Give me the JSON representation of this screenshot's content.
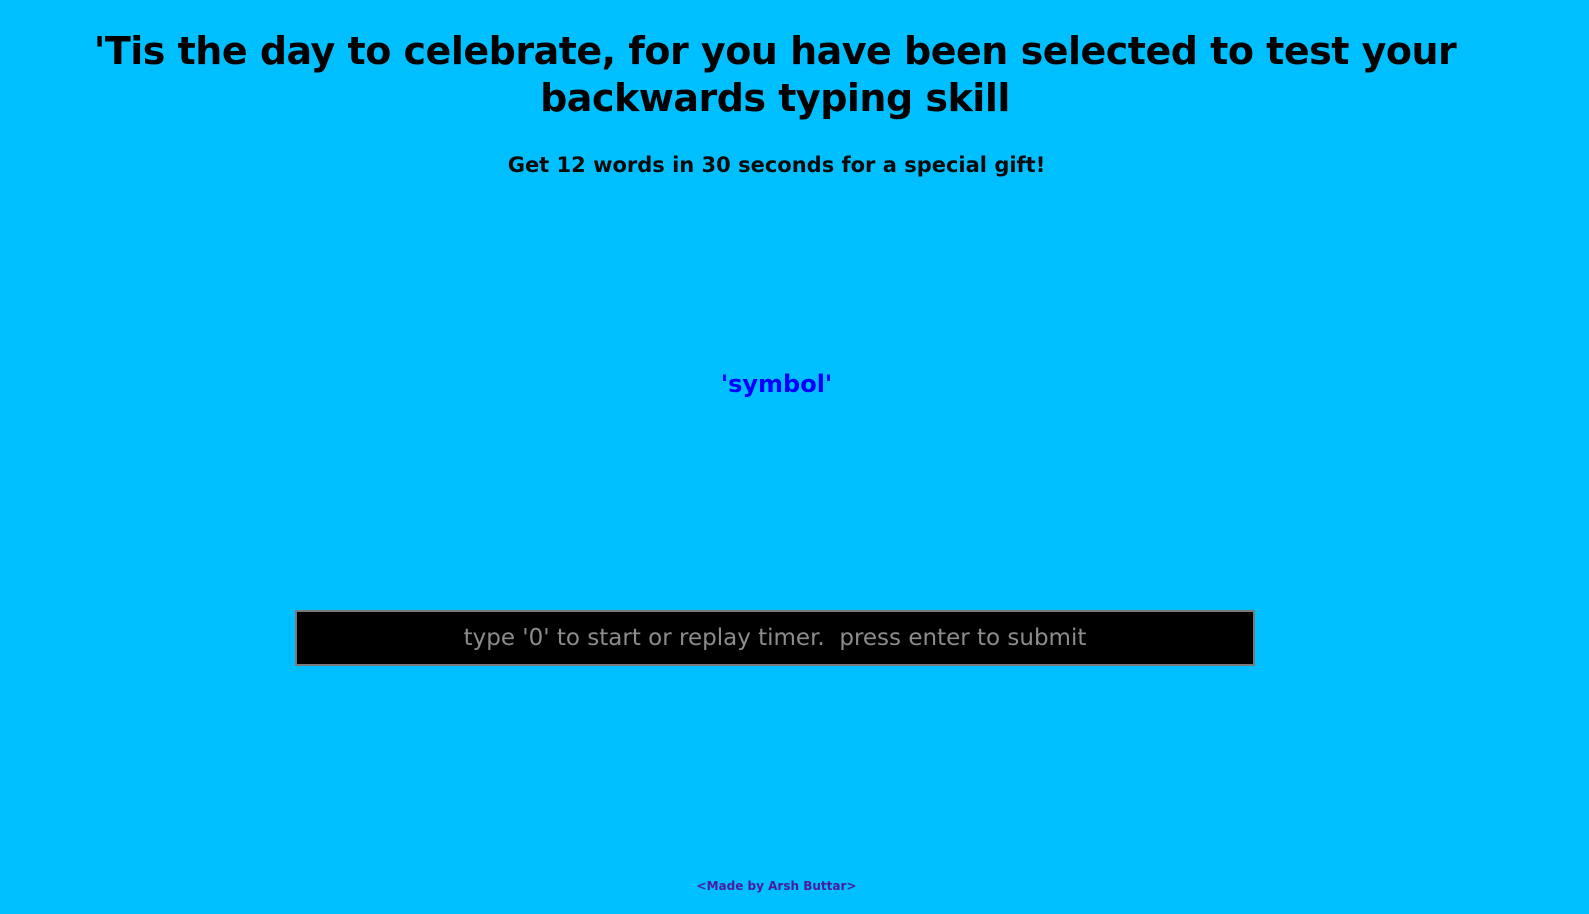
{
  "header": {
    "title": "'Tis the day to celebrate, for you have been selected to test your backwards typing skill",
    "subtitle": "Get 12 words in 30 seconds for a special gift!"
  },
  "game": {
    "current_word": "'symbol'",
    "input_value": "",
    "input_placeholder": "type '0' to start or replay timer.  press enter to submit"
  },
  "footer": {
    "credit": "<Made by Arsh Buttar>"
  },
  "colors": {
    "background": "#00bfff",
    "word": "#0000ff",
    "input_background": "#000000",
    "credit": "#4b1aa0"
  }
}
